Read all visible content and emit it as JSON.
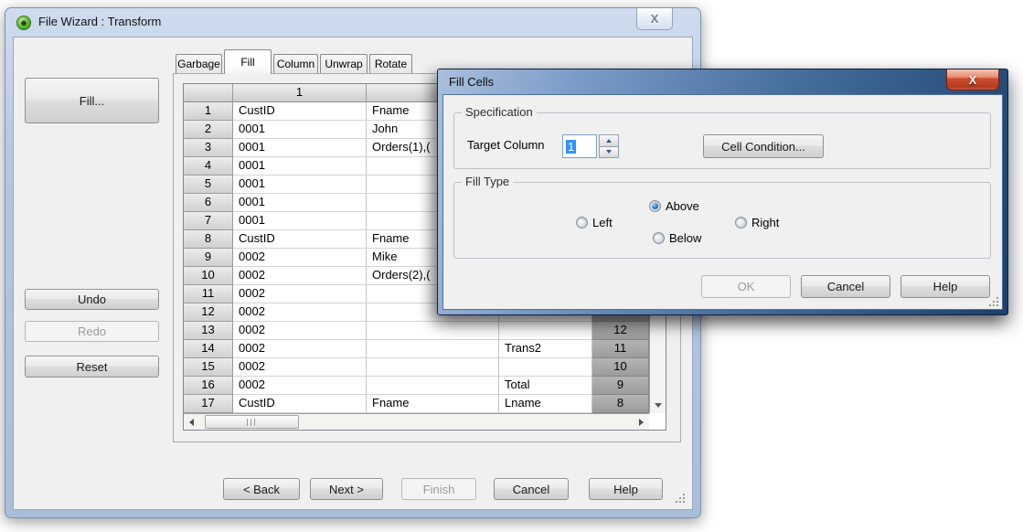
{
  "window": {
    "title": "File Wizard : Transform",
    "close_glyph": "X",
    "tabs": [
      {
        "label": "Garbage",
        "active": false
      },
      {
        "label": "Fill",
        "active": true
      },
      {
        "label": "Column",
        "active": false
      },
      {
        "label": "Unwrap",
        "active": false
      },
      {
        "label": "Rotate",
        "active": false
      }
    ],
    "side_panel": {
      "fill_button": "Fill...",
      "undo_button": "Undo",
      "redo_button": "Redo",
      "reset_button": "Reset"
    },
    "wizard_buttons": {
      "back": "< Back",
      "next": "Next >",
      "finish": "Finish",
      "cancel": "Cancel",
      "help": "Help"
    },
    "grid": {
      "corner_header": "",
      "col1_header": "1",
      "col2_header": "",
      "col3_header": "",
      "col4_header": "",
      "rows": [
        {
          "n": "1",
          "c1": "CustID",
          "c2": "Fname",
          "c3": "",
          "c4": ""
        },
        {
          "n": "2",
          "c1": "0001",
          "c2": "John",
          "c3": "",
          "c4": ""
        },
        {
          "n": "3",
          "c1": "0001",
          "c2": "Orders(1),(",
          "c3": "",
          "c4": ""
        },
        {
          "n": "4",
          "c1": "0001",
          "c2": "",
          "c3": "",
          "c4": ""
        },
        {
          "n": "5",
          "c1": "0001",
          "c2": "",
          "c3": "",
          "c4": ""
        },
        {
          "n": "6",
          "c1": "0001",
          "c2": "",
          "c3": "",
          "c4": ""
        },
        {
          "n": "7",
          "c1": "0001",
          "c2": "",
          "c3": "",
          "c4": ""
        },
        {
          "n": "8",
          "c1": "CustID",
          "c2": "Fname",
          "c3": "",
          "c4": ""
        },
        {
          "n": "9",
          "c1": "0002",
          "c2": "Mike",
          "c3": "",
          "c4": ""
        },
        {
          "n": "10",
          "c1": "0002",
          "c2": "Orders(2),(",
          "c3": "",
          "c4": ""
        },
        {
          "n": "11",
          "c1": "0002",
          "c2": "",
          "c3": "",
          "c4": ""
        },
        {
          "n": "12",
          "c1": "0002",
          "c2": "",
          "c3": "",
          "c4": ""
        },
        {
          "n": "13",
          "c1": "0002",
          "c2": "",
          "c3": "",
          "c4": "12"
        },
        {
          "n": "14",
          "c1": "0002",
          "c2": "",
          "c3": "Trans2",
          "c4": "11"
        },
        {
          "n": "15",
          "c1": "0002",
          "c2": "",
          "c3": "",
          "c4": "10"
        },
        {
          "n": "16",
          "c1": "0002",
          "c2": "",
          "c3": "Total",
          "c4": "9"
        },
        {
          "n": "17",
          "c1": "CustID",
          "c2": "Fname",
          "c3": "Lname",
          "c4": "8"
        }
      ]
    }
  },
  "dialog": {
    "title": "Fill Cells",
    "close_glyph": "X",
    "specification": {
      "group_label": "Specification",
      "target_column_label": "Target Column",
      "target_column_value": "1",
      "cell_condition_button": "Cell Condition..."
    },
    "fill_type": {
      "group_label": "Fill Type",
      "options": [
        {
          "label": "Left",
          "selected": false
        },
        {
          "label": "Above",
          "selected": true
        },
        {
          "label": "Below",
          "selected": false
        },
        {
          "label": "Right",
          "selected": false
        }
      ]
    },
    "buttons": {
      "ok": "OK",
      "cancel": "Cancel",
      "help": "Help"
    },
    "ok_disabled": true
  },
  "colors": {
    "window_frame": "#b4c8e2",
    "dialog_frame_dark": "#1d3f6b",
    "dialog_close_red": "#d14f31",
    "selection_blue": "#3094fa",
    "highlight_column_gray": "#a8a8a8",
    "body_gray": "#f0f0f0"
  }
}
